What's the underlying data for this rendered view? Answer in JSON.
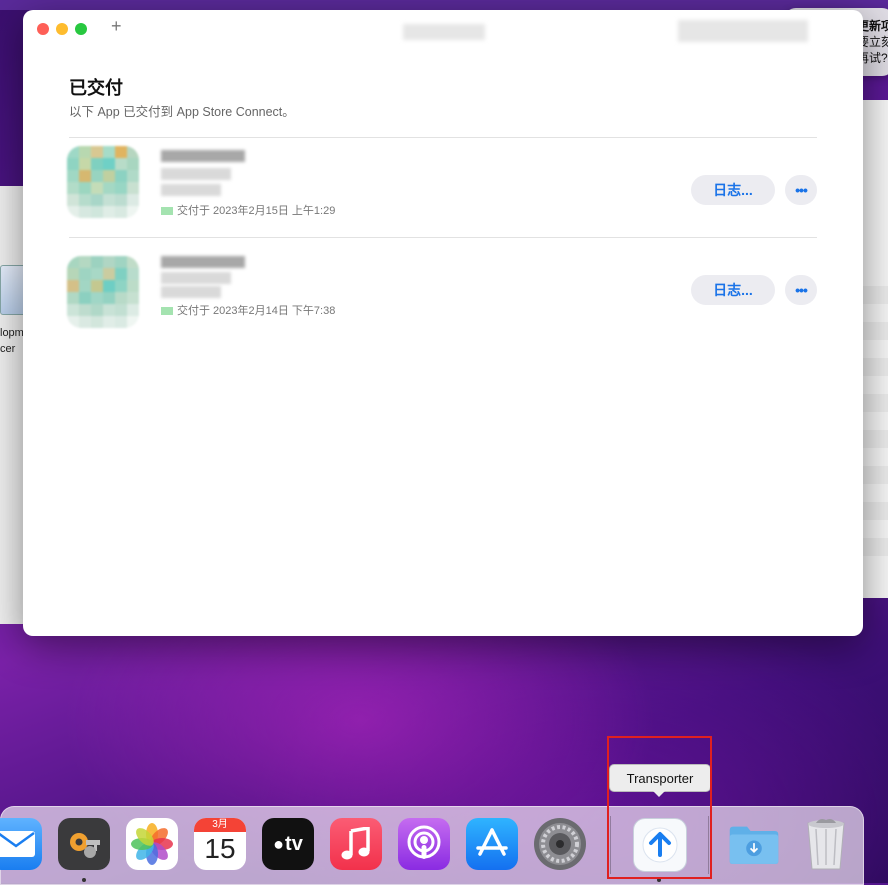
{
  "background_window": {
    "label_line1": "lopm",
    "label_line2": "cer"
  },
  "notification": {
    "icon": "gear-icon",
    "line1": "有更新项",
    "line2": "您要立刻",
    "line3": "晚再试?"
  },
  "window": {
    "new_tab_label": "+",
    "section_title": "已交付",
    "section_subtitle": "以下 App 已交付到 App Store Connect。",
    "items": [
      {
        "delivered_text": "交付于 2023年2月15日 上午1:29",
        "log_label": "日志...",
        "more_label": "•••"
      },
      {
        "delivered_text": "交付于 2023年2月14日 下午7:38",
        "log_label": "日志...",
        "more_label": "•••"
      }
    ]
  },
  "dock": {
    "tooltip": "Transporter",
    "calendar_month": "3月",
    "calendar_day": "15",
    "tv_label": "tv",
    "items": [
      {
        "name": "mail-icon"
      },
      {
        "name": "keychain-icon"
      },
      {
        "name": "photos-icon"
      },
      {
        "name": "calendar-icon"
      },
      {
        "name": "apple-tv-icon"
      },
      {
        "name": "music-icon"
      },
      {
        "name": "podcasts-icon"
      },
      {
        "name": "app-store-icon"
      },
      {
        "name": "system-preferences-icon"
      },
      {
        "name": "transporter-icon"
      },
      {
        "name": "downloads-folder-icon"
      },
      {
        "name": "trash-icon"
      }
    ]
  },
  "colors": {
    "accent": "#1a73e8",
    "highlight": "#e02020"
  }
}
